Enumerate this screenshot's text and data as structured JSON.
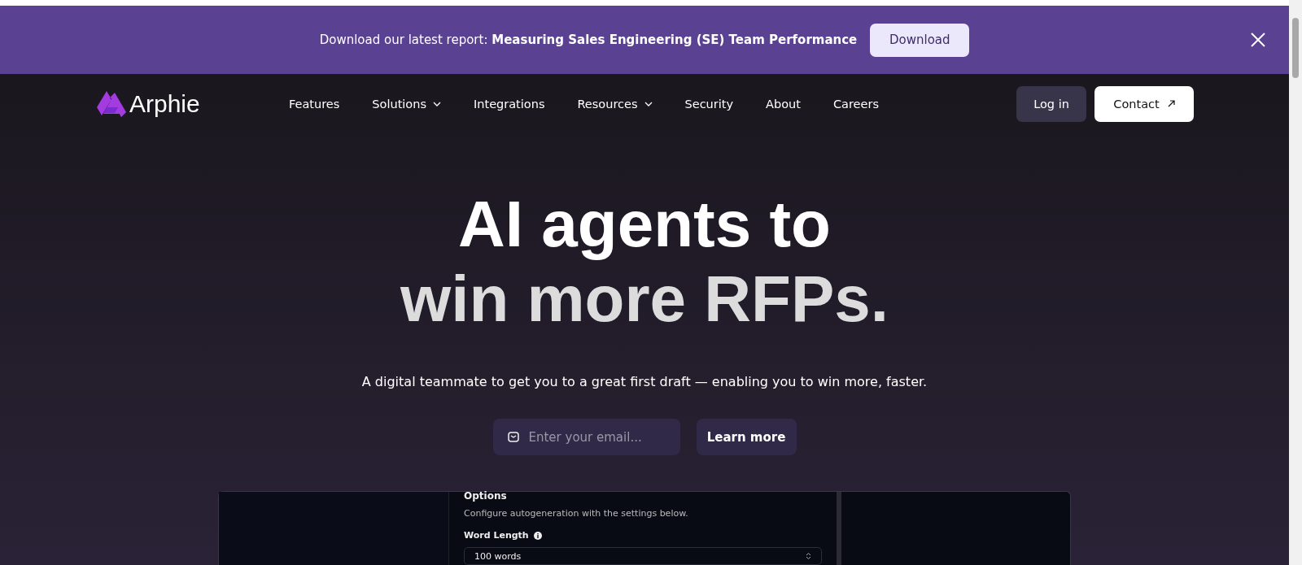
{
  "banner": {
    "text": "Download our latest report: **Measuring Sales Engineering (SE) Team Performance**",
    "button": "Download"
  },
  "nav": {
    "logo": "Arphie",
    "items": [
      {
        "label": "Features",
        "dropdown": false
      },
      {
        "label": "Solutions",
        "dropdown": true
      },
      {
        "label": "Integrations",
        "dropdown": false
      },
      {
        "label": "Resources",
        "dropdown": true
      },
      {
        "label": "Security",
        "dropdown": false
      },
      {
        "label": "About",
        "dropdown": false
      },
      {
        "label": "Careers",
        "dropdown": false
      }
    ],
    "login": "Log in",
    "contact": "Contact"
  },
  "hero": {
    "title_line_1": "AI agents to",
    "title_line_2": "win more RFPs.",
    "subtitle": "A digital teammate to get you to a great first draft — enabling you to win more, faster.",
    "email_placeholder": "Enter your email...",
    "button": "Learn more"
  },
  "preview": {
    "section_title": "Options",
    "description": "Configure autogeneration with the settings below.",
    "field_label": "Word Length",
    "field_value": "100 words"
  }
}
